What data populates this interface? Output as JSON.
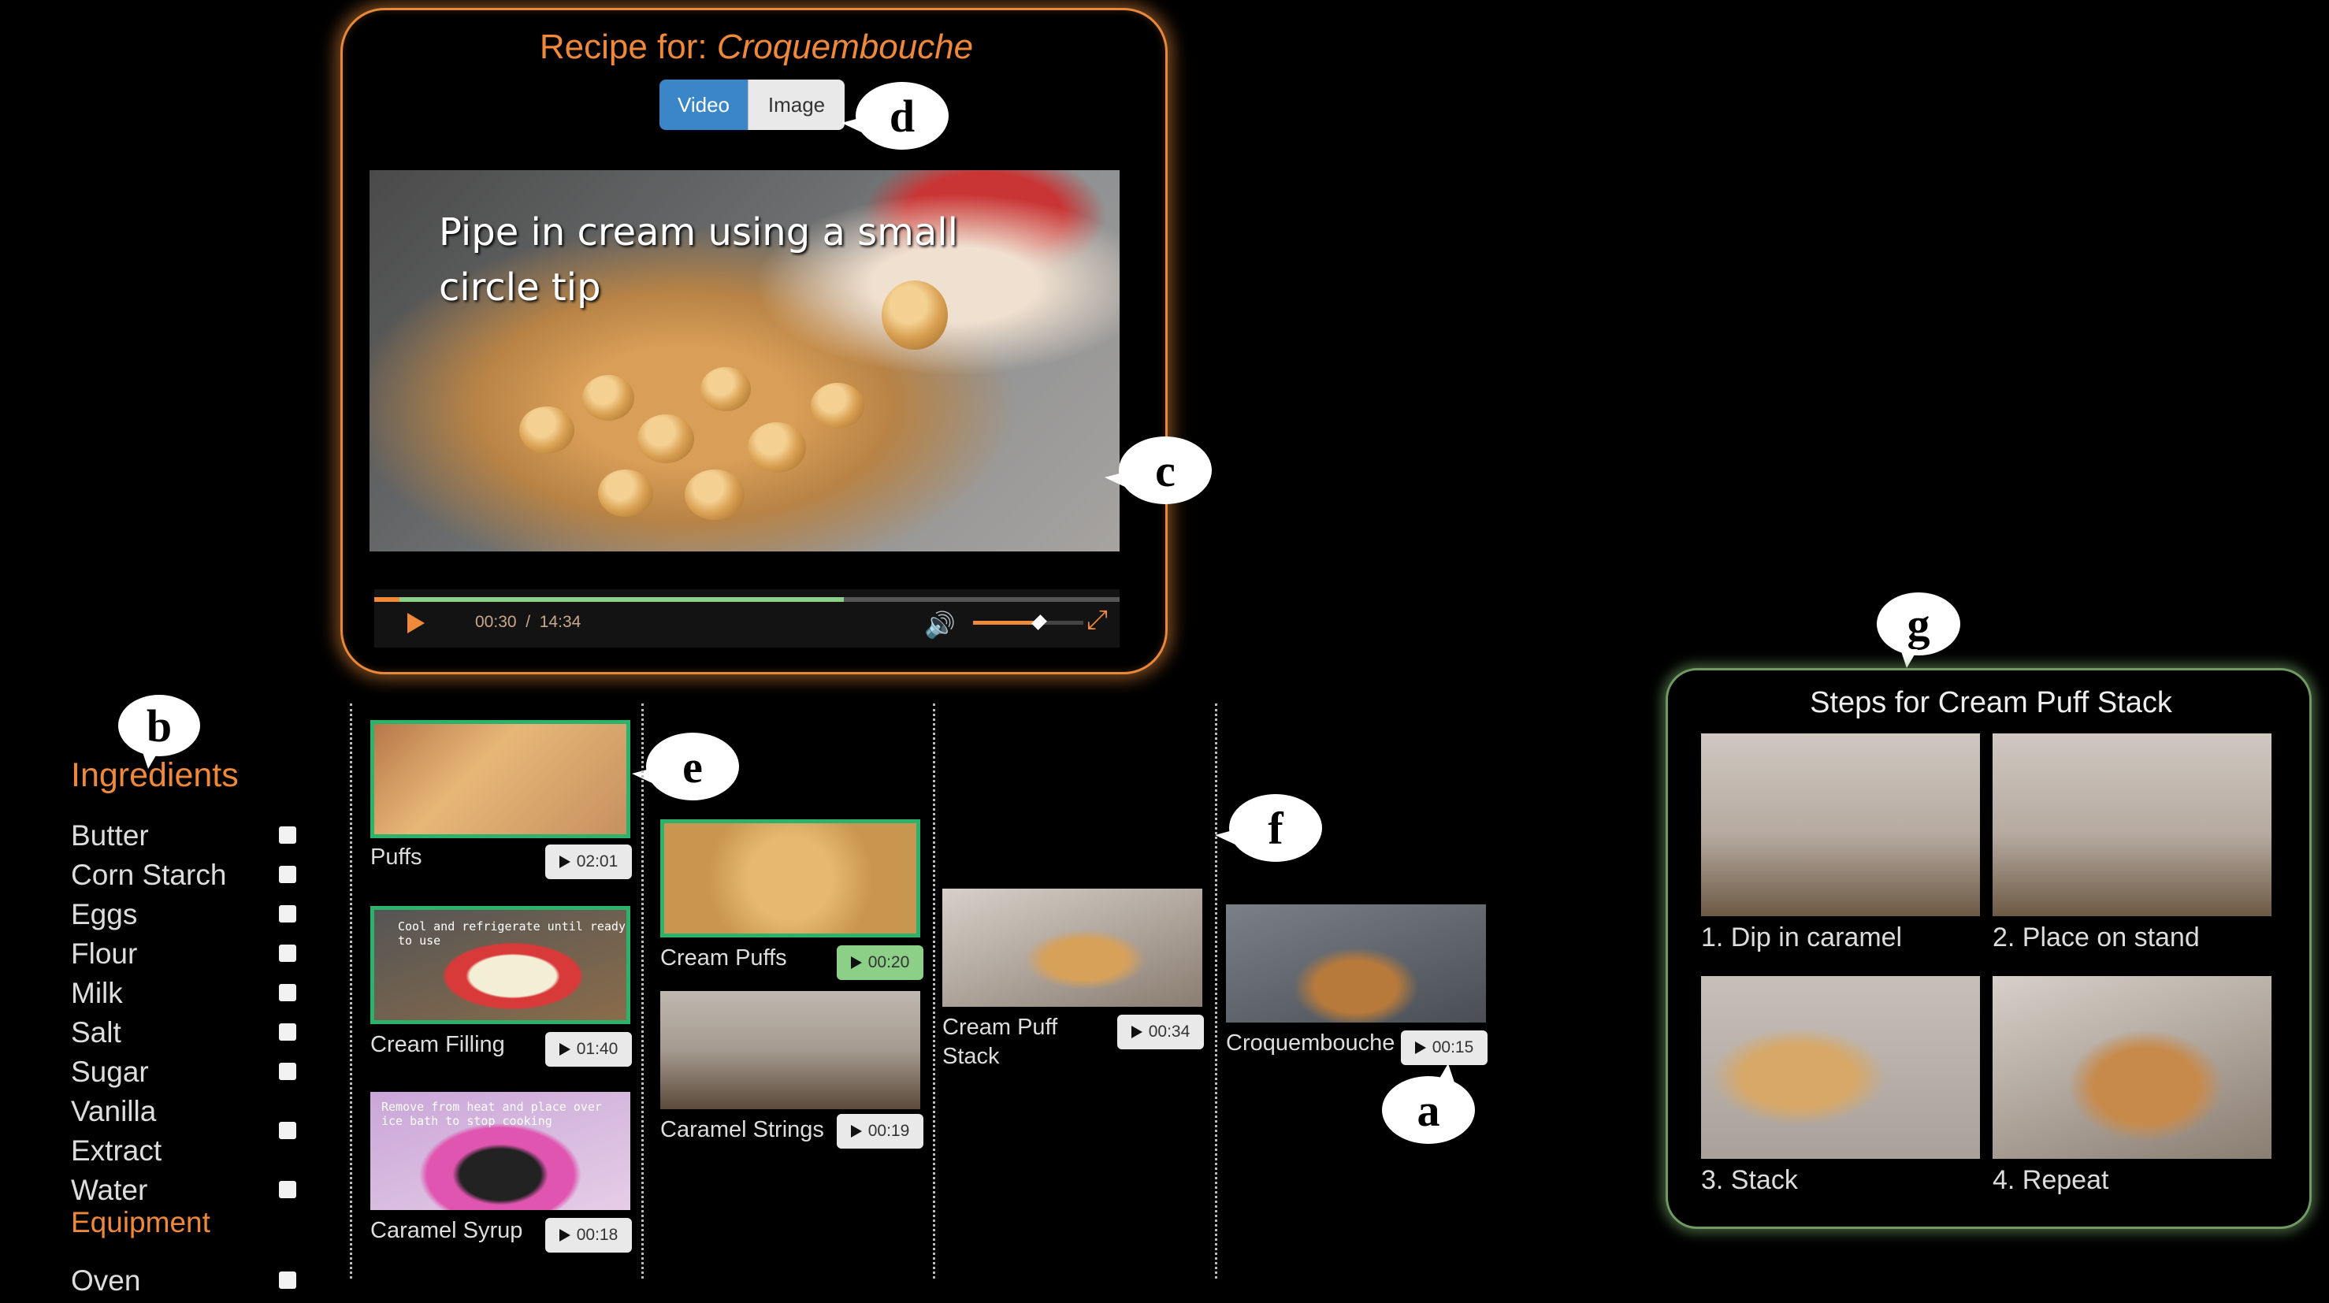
{
  "player": {
    "title_prefix": "Recipe for: ",
    "title_name": "Croquembouche",
    "toggle": {
      "video_label": "Video",
      "image_label": "Image",
      "selected": "Video"
    },
    "overlay_text": "Pipe in cream using a small circle tip",
    "time_current": "00:30",
    "time_separator": "/",
    "time_total": "14:34",
    "progress_fraction": 0.0343,
    "volume_fraction": 0.6
  },
  "callouts": {
    "a": "a",
    "b": "b",
    "c": "c",
    "d": "d",
    "e": "e",
    "f": "f",
    "g": "g"
  },
  "ingredients": {
    "heading": "Ingredients",
    "items": [
      "Butter",
      "Corn Starch",
      "Eggs",
      "Flour",
      "Milk",
      "Salt",
      "Sugar",
      "Vanilla Extract",
      "Water"
    ],
    "equipment_heading": "Equipment",
    "equipment_items": [
      "Oven"
    ]
  },
  "clips": {
    "col1": [
      {
        "label": "Puffs",
        "duration": "02:01"
      },
      {
        "label": "Cream Filling",
        "duration": "01:40",
        "image_text": "Cool and refrigerate until ready to use"
      },
      {
        "label": "Caramel Syrup",
        "duration": "00:18",
        "image_text": "Remove from heat and place over ice bath to stop cooking"
      }
    ],
    "col2": [
      {
        "label": "Cream Puffs",
        "duration": "00:20"
      },
      {
        "label": "Caramel Strings",
        "duration": "00:19"
      }
    ],
    "col3": [
      {
        "label": "Cream Puff Stack",
        "duration": "00:34"
      }
    ],
    "col4": [
      {
        "label": "Croquembouche",
        "duration": "00:15"
      }
    ]
  },
  "steps": {
    "title": "Steps for Cream Puff Stack",
    "items": [
      "1. Dip in caramel",
      "2. Place on stand",
      "3. Stack",
      "4. Repeat"
    ]
  },
  "colors": {
    "accent_orange": "#f0883a",
    "highlight_green": "#2bb36b",
    "toggle_blue": "#3a86c8"
  }
}
